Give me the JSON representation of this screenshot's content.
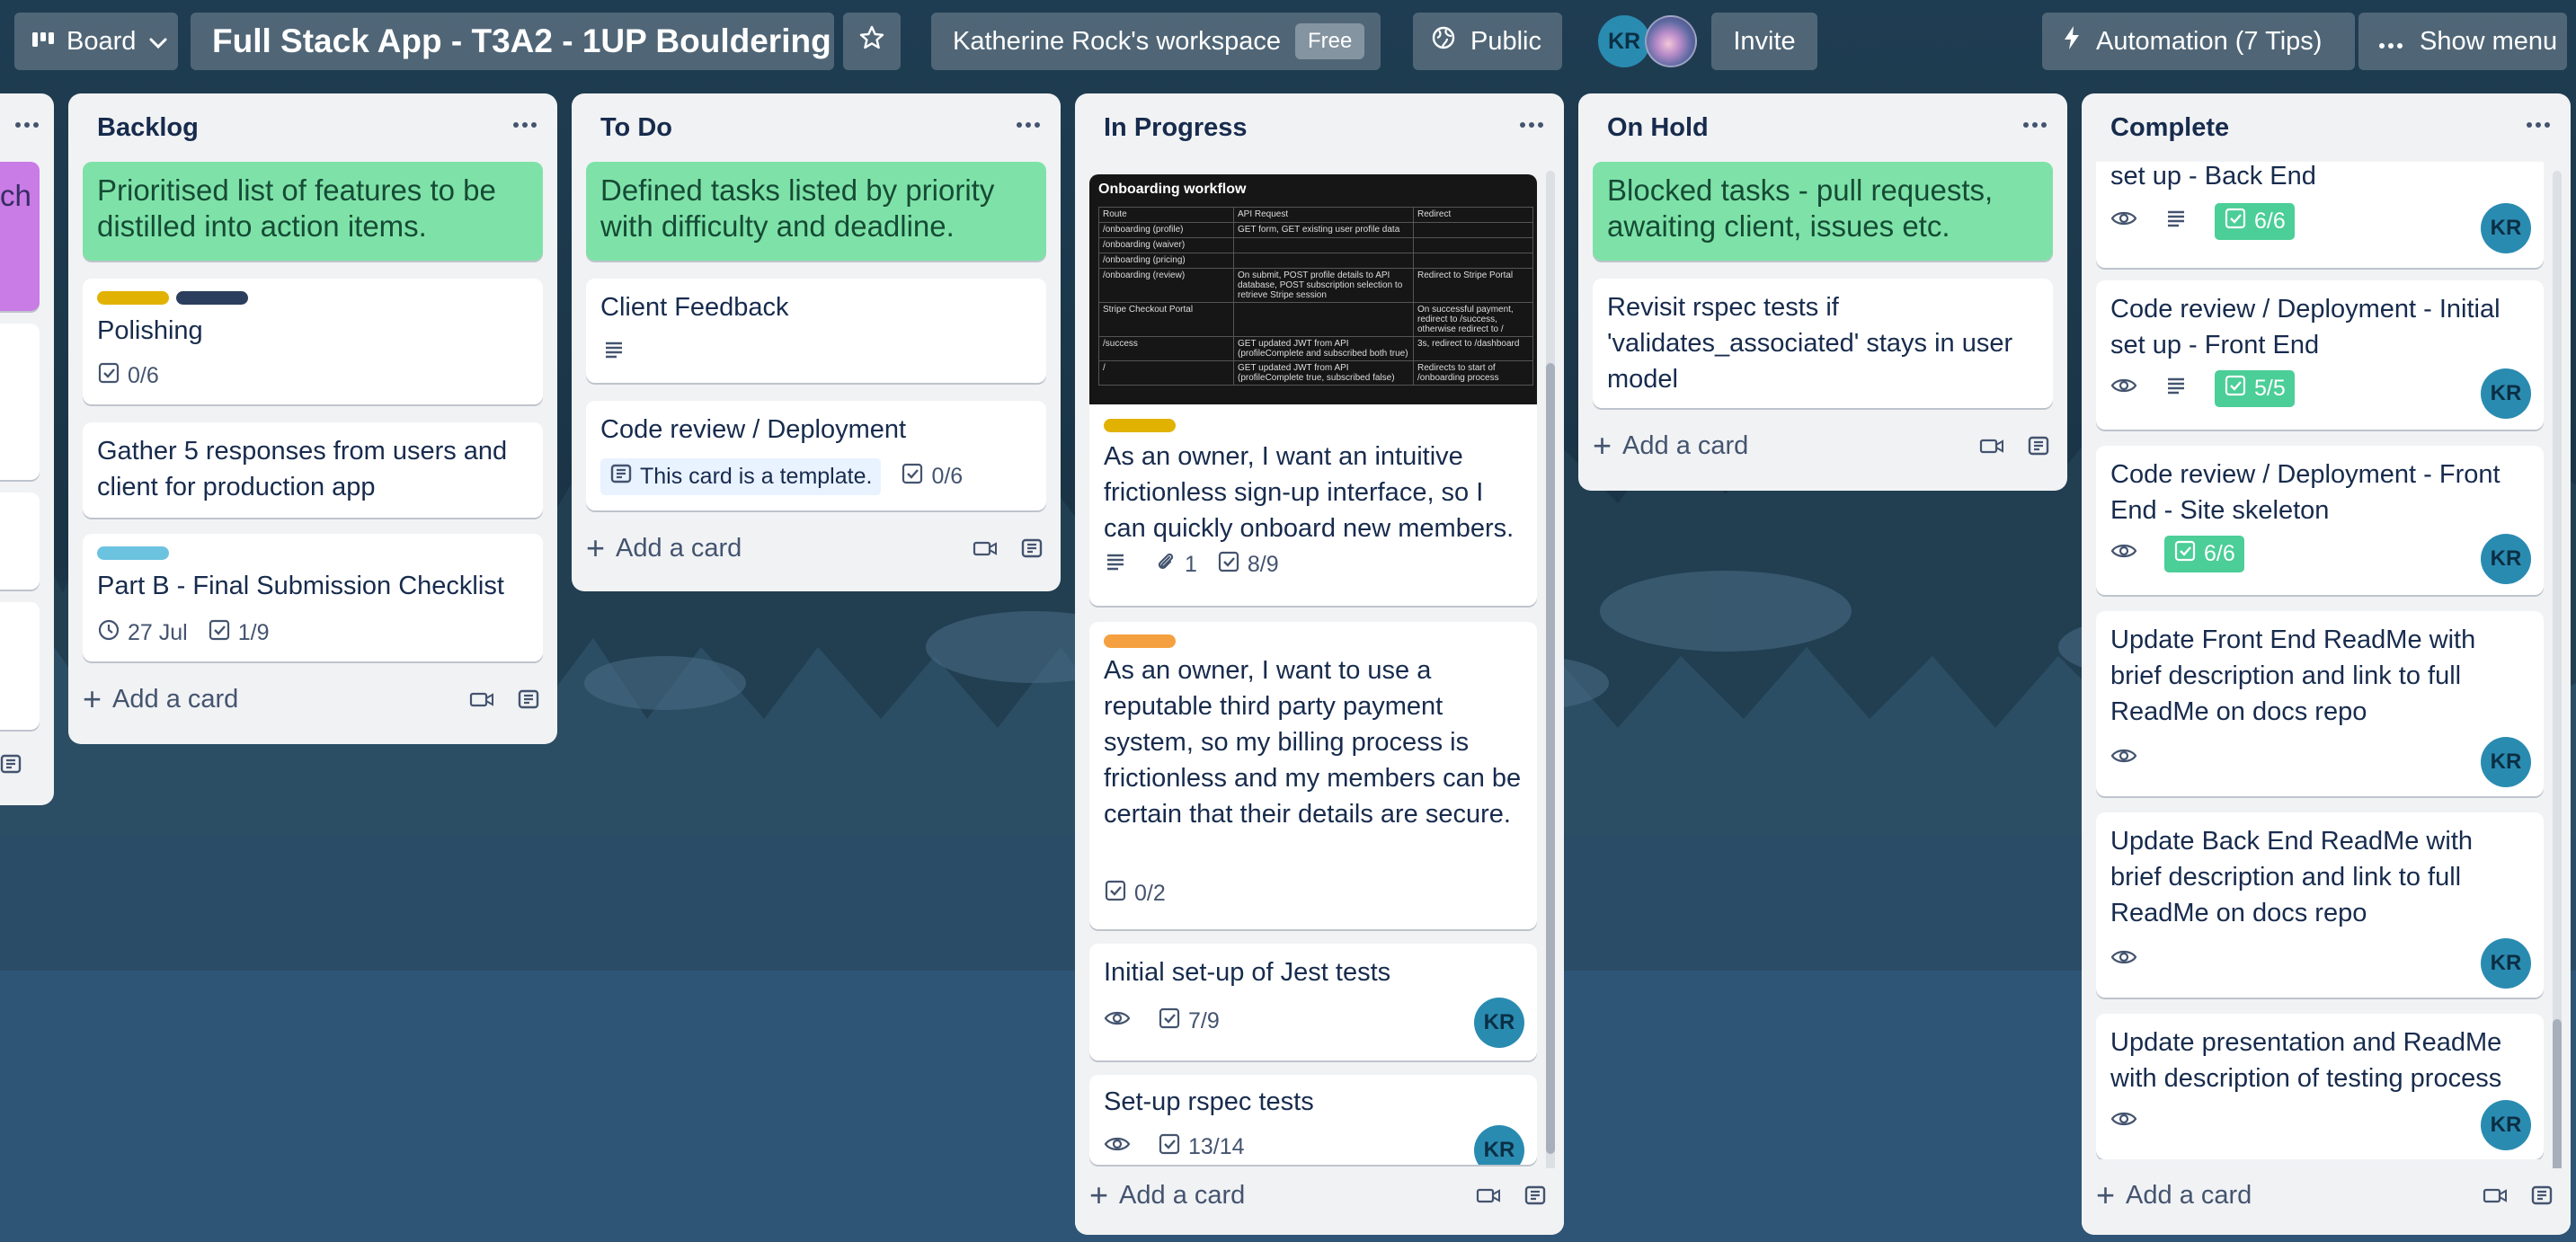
{
  "header": {
    "view_label": "Board",
    "board_title": "Full Stack App - T3A2 - 1UP Bouldering",
    "workspace_name": "Katherine Rock's workspace",
    "workspace_plan": "Free",
    "visibility": "Public",
    "avatar_initials": "KR",
    "invite_label": "Invite",
    "automation_label": "Automation (7 Tips)",
    "menu_label": "Show menu"
  },
  "lists": {
    "partial": {
      "title_fragment": "ch"
    },
    "backlog": {
      "title": "Backlog",
      "cards": [
        {
          "text": "Prioritised list of features to be distilled into action items."
        },
        {
          "text": "Polishing",
          "checklist": "0/6",
          "labels": [
            "#e2b203",
            "#2c3e5d"
          ]
        },
        {
          "text": "Gather 5 responses from users and client for production app"
        },
        {
          "text": "Part B - Final Submission Checklist",
          "due": "27 Jul",
          "checklist": "1/9",
          "labels": [
            "#6cc3e0"
          ]
        }
      ],
      "add_label": "Add a card"
    },
    "todo": {
      "title": "To Do",
      "cards": [
        {
          "text": "Defined tasks listed by priority with difficulty and deadline."
        },
        {
          "text": "Client Feedback"
        },
        {
          "text": "Code review / Deployment",
          "template_label": "This card is a template.",
          "checklist": "0/6"
        }
      ],
      "add_label": "Add a card"
    },
    "in_progress": {
      "title": "In Progress",
      "cover": {
        "title": "Onboarding workflow",
        "header": [
          "Route",
          "API Request",
          "Redirect"
        ],
        "rows": [
          [
            "/onboarding (profile)",
            "GET form, GET existing user profile data",
            ""
          ],
          [
            "/onboarding (waiver)",
            "",
            ""
          ],
          [
            "/onboarding (pricing)",
            "",
            ""
          ],
          [
            "/onboarding (review)",
            "On submit, POST profile details to API database, POST subscription selection to retrieve Stripe session",
            "Redirect to Stripe Portal"
          ],
          [
            "Stripe Checkout Portal",
            "",
            "On successful payment, redirect to /success, otherwise redirect to /"
          ],
          [
            "/success",
            "GET updated JWT from API (profileComplete and subscribed both true)",
            "3s, redirect to /dashboard"
          ],
          [
            "/",
            "GET updated JWT from API (profileComplete true, subscribed false)",
            "Redirects to start of /onboarding process"
          ]
        ]
      },
      "cards": [
        {
          "text": "As an owner, I want an intuitive frictionless sign-up interface, so I can quickly onboard new members.",
          "attachments": "1",
          "checklist": "8/9",
          "labels": [
            "#e2b203"
          ]
        },
        {
          "text": "As an owner, I want to use a reputable third party payment system, so my billing process is frictionless and my members can be certain that their details are secure.",
          "checklist": "0/2",
          "labels": [
            "#f5a040"
          ]
        },
        {
          "text": "Initial set-up of Jest tests",
          "checklist": "7/9",
          "member": "KR"
        },
        {
          "text": "Set-up rspec tests",
          "checklist": "13/14",
          "member": "KR"
        }
      ],
      "add_label": "Add a card"
    },
    "on_hold": {
      "title": "On Hold",
      "cards": [
        {
          "text": "Blocked tasks - pull requests, awaiting client, issues etc."
        },
        {
          "text": "Revisit rspec tests if 'validates_associated' stays in user model"
        }
      ],
      "add_label": "Add a card"
    },
    "complete": {
      "title": "Complete",
      "cards": [
        {
          "text": "set up - Back End",
          "checklist": "6/6",
          "member": "KR"
        },
        {
          "text": "Code review / Deployment - Initial set up - Front End",
          "checklist": "5/5",
          "member": "KR"
        },
        {
          "text": "Code review / Deployment - Front End - Site skeleton",
          "checklist": "6/6",
          "member": "KR"
        },
        {
          "text": "Update Front End ReadMe with brief description and link to full ReadMe on docs repo",
          "member": "KR"
        },
        {
          "text": "Update Back End ReadMe with brief description and link to full ReadMe on docs repo",
          "member": "KR"
        },
        {
          "text": "Update presentation and ReadMe with description of testing process",
          "member": "KR"
        }
      ],
      "add_label": "Add a card"
    }
  },
  "colors": {
    "card_green": "#7ee2a8",
    "list_bg": "#f1f2f4",
    "avatar": "#2a8bb1",
    "checklist_done": "#4bce97",
    "label_yellow": "#e2b203",
    "label_navy": "#2c3e5d",
    "label_sky": "#6cc3e0",
    "label_orange": "#f5a040",
    "template_bg": "#e9f2ff"
  },
  "icons": [
    "board-icon",
    "chevron-down-icon",
    "star-icon",
    "globe-icon",
    "bolt-icon",
    "ellipsis-icon",
    "description-icon",
    "checklist-icon",
    "clock-icon",
    "attachment-icon",
    "watch-eye-icon",
    "template-icon",
    "video-icon",
    "card-template-icon",
    "plus-icon"
  ]
}
